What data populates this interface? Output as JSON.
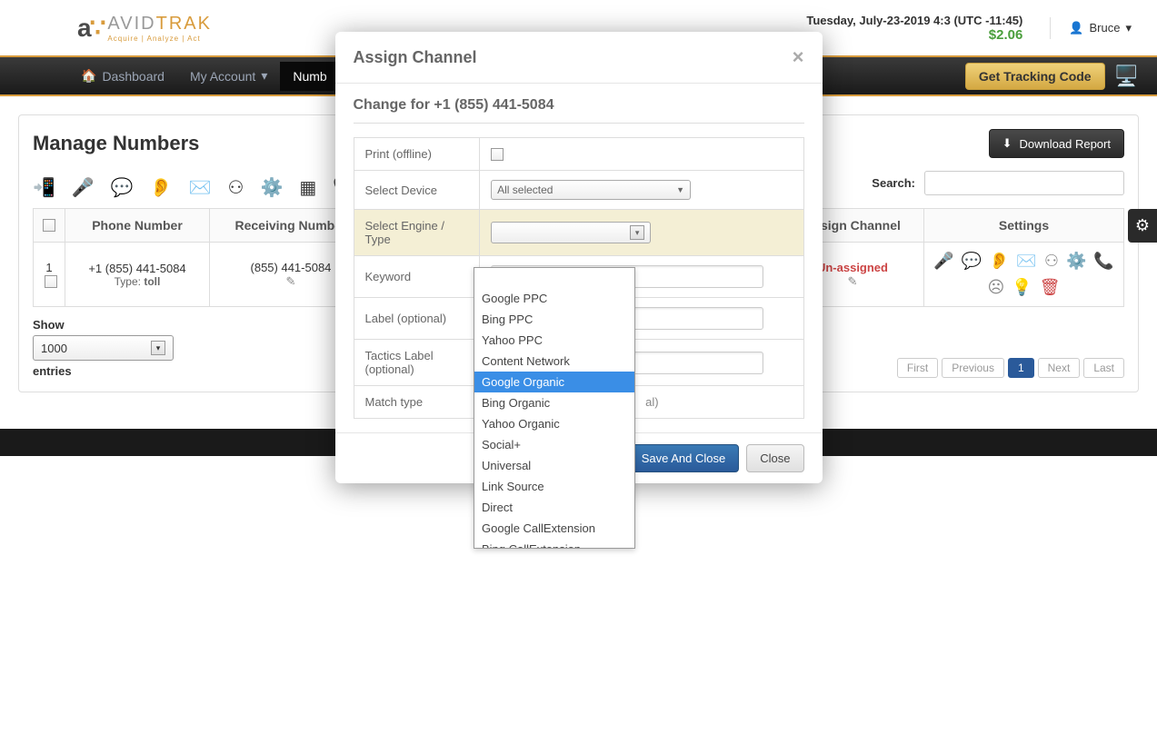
{
  "header": {
    "brand_avid": "AVID",
    "brand_trak": "TRAK",
    "tagline": "Acquire | Analyze | Act",
    "datetime": "Tuesday, July-23-2019 4:3 (UTC -11:45)",
    "balance": "$2.06",
    "user_name": "Bruce"
  },
  "nav": {
    "dashboard": "Dashboard",
    "my_account": "My Account",
    "numbers": "Numb",
    "tracking_code": "Get Tracking Code"
  },
  "page": {
    "title": "Manage Numbers",
    "download_report": "Download Report",
    "search_label": "Search:",
    "show_label": "Show",
    "show_value": "1000",
    "entries_label": "entries"
  },
  "table": {
    "cols": {
      "phone_number": "Phone Number",
      "receiving_number": "Receiving Number",
      "assign_channel": "Assign Channel",
      "settings": "Settings"
    },
    "row": {
      "index": "1",
      "phone": "+1 (855) 441-5084",
      "type_label": "Type:",
      "type_value": "toll",
      "receiving": "(855) 441-5084",
      "channel": "Un-assigned"
    }
  },
  "pagination": {
    "first": "First",
    "previous": "Previous",
    "page1": "1",
    "next": "Next",
    "last": "Last"
  },
  "modal": {
    "title": "Assign Channel",
    "subtitle": "Change for +1 (855) 441-5084",
    "rows": {
      "print_offline": "Print (offline)",
      "select_device": "Select Device",
      "device_value": "All selected",
      "select_engine": "Select Engine / Type",
      "engine_value": "",
      "keyword": "Keyword",
      "label_optional": "Label (optional)",
      "tactics_label": "Tactics Label (optional)",
      "match_type": "Match type",
      "match_hint": "al)"
    },
    "save_close": "Save And Close",
    "close": "Close"
  },
  "dropdown": {
    "items": [
      "Google PPC",
      "Bing PPC",
      "Yahoo PPC",
      "Content Network",
      "Google Organic",
      "Bing Organic",
      "Yahoo Organic",
      "Social+",
      "Universal",
      "Link Source",
      "Direct",
      "Google CallExtension",
      "Bing CallExtension"
    ],
    "selected_index": 4
  }
}
